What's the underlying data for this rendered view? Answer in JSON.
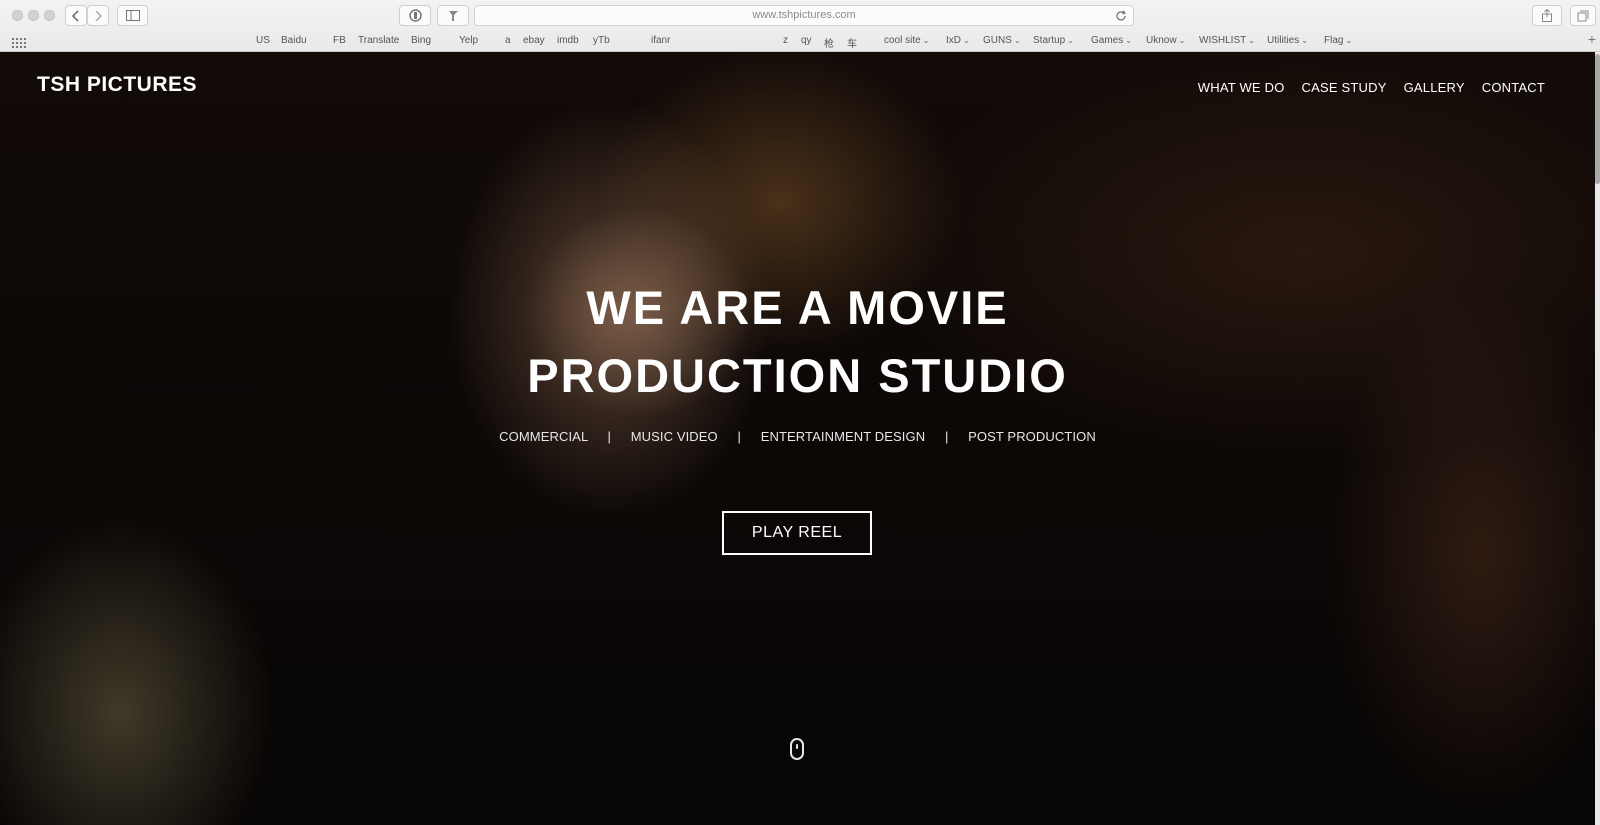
{
  "browser": {
    "url": "www.tshpictures.com",
    "bookmarks": [
      {
        "label": "US",
        "menu": false
      },
      {
        "label": "Baidu",
        "menu": false
      },
      {
        "label": "FB",
        "menu": false
      },
      {
        "label": "Translate",
        "menu": false
      },
      {
        "label": "Bing",
        "menu": false
      },
      {
        "label": "Yelp",
        "menu": false
      },
      {
        "label": "a",
        "menu": false
      },
      {
        "label": "ebay",
        "menu": false
      },
      {
        "label": "imdb",
        "menu": false
      },
      {
        "label": "yTb",
        "menu": false
      },
      {
        "label": "ifanr",
        "menu": false
      },
      {
        "label": "z",
        "menu": false
      },
      {
        "label": "qy",
        "menu": false
      },
      {
        "label": "枪",
        "menu": false
      },
      {
        "label": "车",
        "menu": false
      },
      {
        "label": "cool site",
        "menu": true
      },
      {
        "label": "IxD",
        "menu": true
      },
      {
        "label": "GUNS",
        "menu": true
      },
      {
        "label": "Startup",
        "menu": true
      },
      {
        "label": "Games",
        "menu": true
      },
      {
        "label": "Uknow",
        "menu": true
      },
      {
        "label": "WISHLIST",
        "menu": true
      },
      {
        "label": "Utilities",
        "menu": true
      },
      {
        "label": "Flag",
        "menu": true
      }
    ],
    "icons": [
      "back-icon",
      "forward-icon",
      "sidebar-icon",
      "privacy-icon",
      "pin-icon",
      "reload-icon",
      "share-icon",
      "tabs-icon",
      "apps-grid-icon",
      "new-tab-icon"
    ]
  },
  "site": {
    "logo": "TSH PICTURES",
    "nav": [
      "WHAT WE DO",
      "CASE STUDY",
      "GALLERY",
      "CONTACT"
    ],
    "headline_line1": "WE ARE A MOVIE",
    "headline_line2": "PRODUCTION STUDIO",
    "services": [
      "COMMERCIAL",
      "MUSIC VIDEO",
      "ENTERTAINMENT DESIGN",
      "POST PRODUCTION"
    ],
    "separator": "|",
    "cta_label": "PLAY REEL"
  }
}
